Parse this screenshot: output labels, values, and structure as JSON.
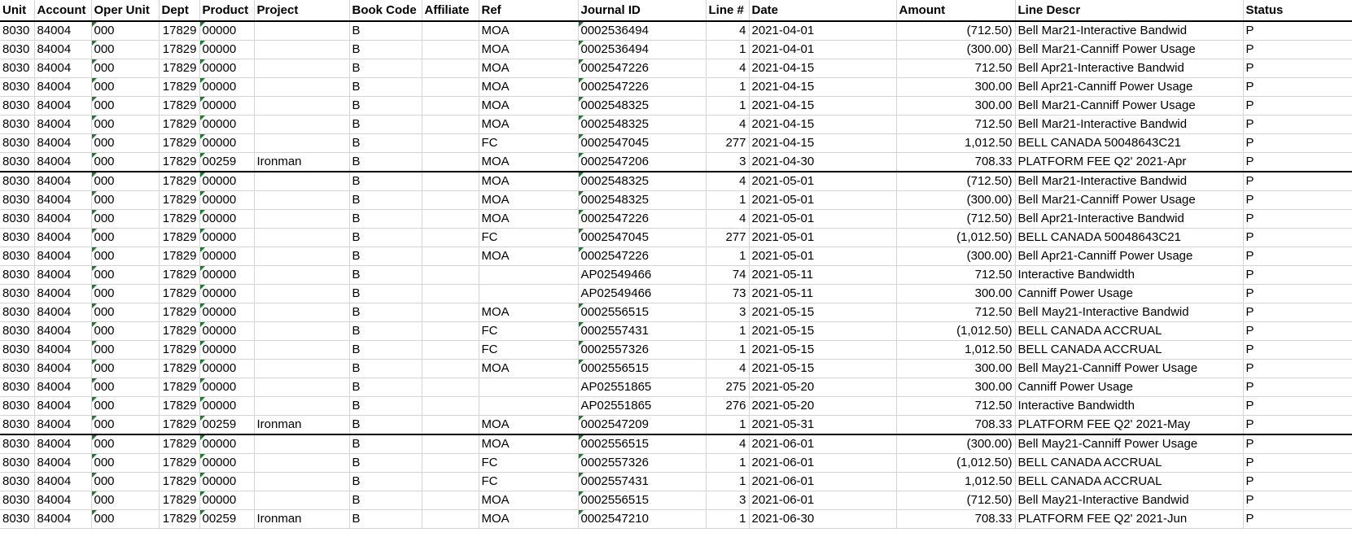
{
  "headers": [
    "Unit",
    "Account",
    "Oper Unit",
    "Dept",
    "Product",
    "Project",
    "Book Code",
    "Affiliate",
    "Ref",
    "Journal ID",
    "Line #",
    "Date",
    "Amount",
    "Line Descr",
    "Status"
  ],
  "rows": [
    [
      "8030",
      "84004",
      "000",
      "17829",
      "00000",
      "",
      "B",
      "",
      "MOA",
      "0002536494",
      "4",
      "2021-04-01",
      "(712.50)",
      "Bell Mar21-Interactive Bandwid",
      "P"
    ],
    [
      "8030",
      "84004",
      "000",
      "17829",
      "00000",
      "",
      "B",
      "",
      "MOA",
      "0002536494",
      "1",
      "2021-04-01",
      "(300.00)",
      "Bell Mar21-Canniff Power Usage",
      "P"
    ],
    [
      "8030",
      "84004",
      "000",
      "17829",
      "00000",
      "",
      "B",
      "",
      "MOA",
      "0002547226",
      "4",
      "2021-04-15",
      "712.50",
      "Bell Apr21-Interactive Bandwid",
      "P"
    ],
    [
      "8030",
      "84004",
      "000",
      "17829",
      "00000",
      "",
      "B",
      "",
      "MOA",
      "0002547226",
      "1",
      "2021-04-15",
      "300.00",
      "Bell Apr21-Canniff Power Usage",
      "P"
    ],
    [
      "8030",
      "84004",
      "000",
      "17829",
      "00000",
      "",
      "B",
      "",
      "MOA",
      "0002548325",
      "1",
      "2021-04-15",
      "300.00",
      "Bell Mar21-Canniff Power Usage",
      "P"
    ],
    [
      "8030",
      "84004",
      "000",
      "17829",
      "00000",
      "",
      "B",
      "",
      "MOA",
      "0002548325",
      "4",
      "2021-04-15",
      "712.50",
      "Bell Mar21-Interactive Bandwid",
      "P"
    ],
    [
      "8030",
      "84004",
      "000",
      "17829",
      "00000",
      "",
      "B",
      "",
      "FC",
      "0002547045",
      "277",
      "2021-04-15",
      "1,012.50",
      "BELL CANADA 50048643C21",
      "P"
    ],
    [
      "8030",
      "84004",
      "000",
      "17829",
      "00259",
      "Ironman",
      "B",
      "",
      "MOA",
      "0002547206",
      "3",
      "2021-04-30",
      "708.33",
      "PLATFORM FEE Q2' 2021-Apr",
      "P"
    ],
    [
      "8030",
      "84004",
      "000",
      "17829",
      "00000",
      "",
      "B",
      "",
      "MOA",
      "0002548325",
      "4",
      "2021-05-01",
      "(712.50)",
      "Bell Mar21-Interactive Bandwid",
      "P"
    ],
    [
      "8030",
      "84004",
      "000",
      "17829",
      "00000",
      "",
      "B",
      "",
      "MOA",
      "0002548325",
      "1",
      "2021-05-01",
      "(300.00)",
      "Bell Mar21-Canniff Power Usage",
      "P"
    ],
    [
      "8030",
      "84004",
      "000",
      "17829",
      "00000",
      "",
      "B",
      "",
      "MOA",
      "0002547226",
      "4",
      "2021-05-01",
      "(712.50)",
      "Bell Apr21-Interactive Bandwid",
      "P"
    ],
    [
      "8030",
      "84004",
      "000",
      "17829",
      "00000",
      "",
      "B",
      "",
      "FC",
      "0002547045",
      "277",
      "2021-05-01",
      "(1,012.50)",
      "BELL CANADA 50048643C21",
      "P"
    ],
    [
      "8030",
      "84004",
      "000",
      "17829",
      "00000",
      "",
      "B",
      "",
      "MOA",
      "0002547226",
      "1",
      "2021-05-01",
      "(300.00)",
      "Bell Apr21-Canniff Power Usage",
      "P"
    ],
    [
      "8030",
      "84004",
      "000",
      "17829",
      "00000",
      "",
      "B",
      "",
      "",
      "AP02549466",
      "74",
      "2021-05-11",
      "712.50",
      "Interactive Bandwidth",
      "P"
    ],
    [
      "8030",
      "84004",
      "000",
      "17829",
      "00000",
      "",
      "B",
      "",
      "",
      "AP02549466",
      "73",
      "2021-05-11",
      "300.00",
      "Canniff Power Usage",
      "P"
    ],
    [
      "8030",
      "84004",
      "000",
      "17829",
      "00000",
      "",
      "B",
      "",
      "MOA",
      "0002556515",
      "3",
      "2021-05-15",
      "712.50",
      "Bell May21-Interactive Bandwid",
      "P"
    ],
    [
      "8030",
      "84004",
      "000",
      "17829",
      "00000",
      "",
      "B",
      "",
      "FC",
      "0002557431",
      "1",
      "2021-05-15",
      "(1,012.50)",
      "BELL CANADA ACCRUAL",
      "P"
    ],
    [
      "8030",
      "84004",
      "000",
      "17829",
      "00000",
      "",
      "B",
      "",
      "FC",
      "0002557326",
      "1",
      "2021-05-15",
      "1,012.50",
      "BELL CANADA ACCRUAL",
      "P"
    ],
    [
      "8030",
      "84004",
      "000",
      "17829",
      "00000",
      "",
      "B",
      "",
      "MOA",
      "0002556515",
      "4",
      "2021-05-15",
      "300.00",
      "Bell May21-Canniff Power Usage",
      "P"
    ],
    [
      "8030",
      "84004",
      "000",
      "17829",
      "00000",
      "",
      "B",
      "",
      "",
      "AP02551865",
      "275",
      "2021-05-20",
      "300.00",
      "Canniff Power Usage",
      "P"
    ],
    [
      "8030",
      "84004",
      "000",
      "17829",
      "00000",
      "",
      "B",
      "",
      "",
      "AP02551865",
      "276",
      "2021-05-20",
      "712.50",
      "Interactive Bandwidth",
      "P"
    ],
    [
      "8030",
      "84004",
      "000",
      "17829",
      "00259",
      "Ironman",
      "B",
      "",
      "MOA",
      "0002547209",
      "1",
      "2021-05-31",
      "708.33",
      "PLATFORM FEE Q2' 2021-May",
      "P"
    ],
    [
      "8030",
      "84004",
      "000",
      "17829",
      "00000",
      "",
      "B",
      "",
      "MOA",
      "0002556515",
      "4",
      "2021-06-01",
      "(300.00)",
      "Bell May21-Canniff Power Usage",
      "P"
    ],
    [
      "8030",
      "84004",
      "000",
      "17829",
      "00000",
      "",
      "B",
      "",
      "FC",
      "0002557326",
      "1",
      "2021-06-01",
      "(1,012.50)",
      "BELL CANADA ACCRUAL",
      "P"
    ],
    [
      "8030",
      "84004",
      "000",
      "17829",
      "00000",
      "",
      "B",
      "",
      "FC",
      "0002557431",
      "1",
      "2021-06-01",
      "1,012.50",
      "BELL CANADA ACCRUAL",
      "P"
    ],
    [
      "8030",
      "84004",
      "000",
      "17829",
      "00000",
      "",
      "B",
      "",
      "MOA",
      "0002556515",
      "3",
      "2021-06-01",
      "(712.50)",
      "Bell May21-Interactive Bandwid",
      "P"
    ],
    [
      "8030",
      "84004",
      "000",
      "17829",
      "00259",
      "Ironman",
      "B",
      "",
      "MOA",
      "0002547210",
      "1",
      "2021-06-30",
      "708.33",
      "PLATFORM FEE Q2' 2021-Jun",
      "P"
    ]
  ]
}
